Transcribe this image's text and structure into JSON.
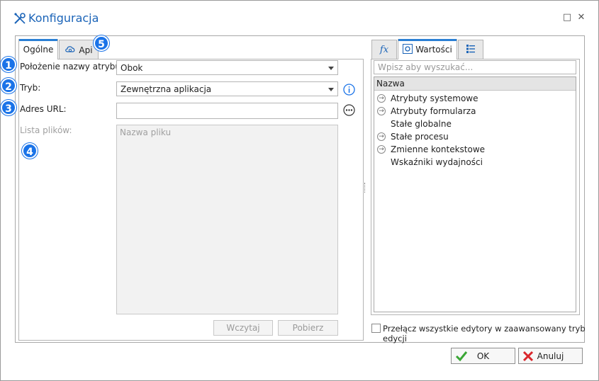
{
  "window": {
    "title": "Konfiguracja",
    "minimize_glyph": "□",
    "close_glyph": "✕"
  },
  "left_tabs": [
    {
      "label": "Ogólne",
      "active": true
    },
    {
      "label": "Api",
      "active": false
    }
  ],
  "form": {
    "position_label": "Położenie nazwy atrybutu:",
    "position_value": "Obok",
    "mode_label": "Tryb:",
    "mode_value": "Zewnętrzna aplikacja",
    "url_label": "Adres URL:",
    "url_value": "",
    "files_label": "Lista plików:",
    "files_column": "Nazwa pliku",
    "load_button": "Wczytaj",
    "download_button": "Pobierz"
  },
  "badges": [
    "1",
    "2",
    "3",
    "4",
    "5"
  ],
  "right_tabs": [
    {
      "label": "",
      "icon": "function-icon",
      "active": false
    },
    {
      "label": "Wartości",
      "icon": "values-icon",
      "active": true
    },
    {
      "label": "",
      "icon": "list-icon",
      "active": false
    }
  ],
  "right_panel": {
    "search_placeholder": "Wpisz aby wyszukać...",
    "column_header": "Nazwa",
    "items": [
      {
        "label": "Atrybuty systemowe",
        "expandable": true
      },
      {
        "label": "Atrybuty formularza",
        "expandable": true
      },
      {
        "label": "Stałe globalne",
        "expandable": false
      },
      {
        "label": "Stałe procesu",
        "expandable": true
      },
      {
        "label": "Zmienne kontekstowe",
        "expandable": true
      },
      {
        "label": "Wskaźniki wydajności",
        "expandable": false
      }
    ],
    "advanced_toggle_label": "Przełącz wszystkie edytory w zaawansowany tryb edycji"
  },
  "footer": {
    "ok_label": "OK",
    "cancel_label": "Anuluj"
  },
  "colors": {
    "accent": "#1b64b8",
    "badge": "#1a73e8",
    "ok_check": "#3aa635",
    "cancel_x": "#d9262b"
  }
}
